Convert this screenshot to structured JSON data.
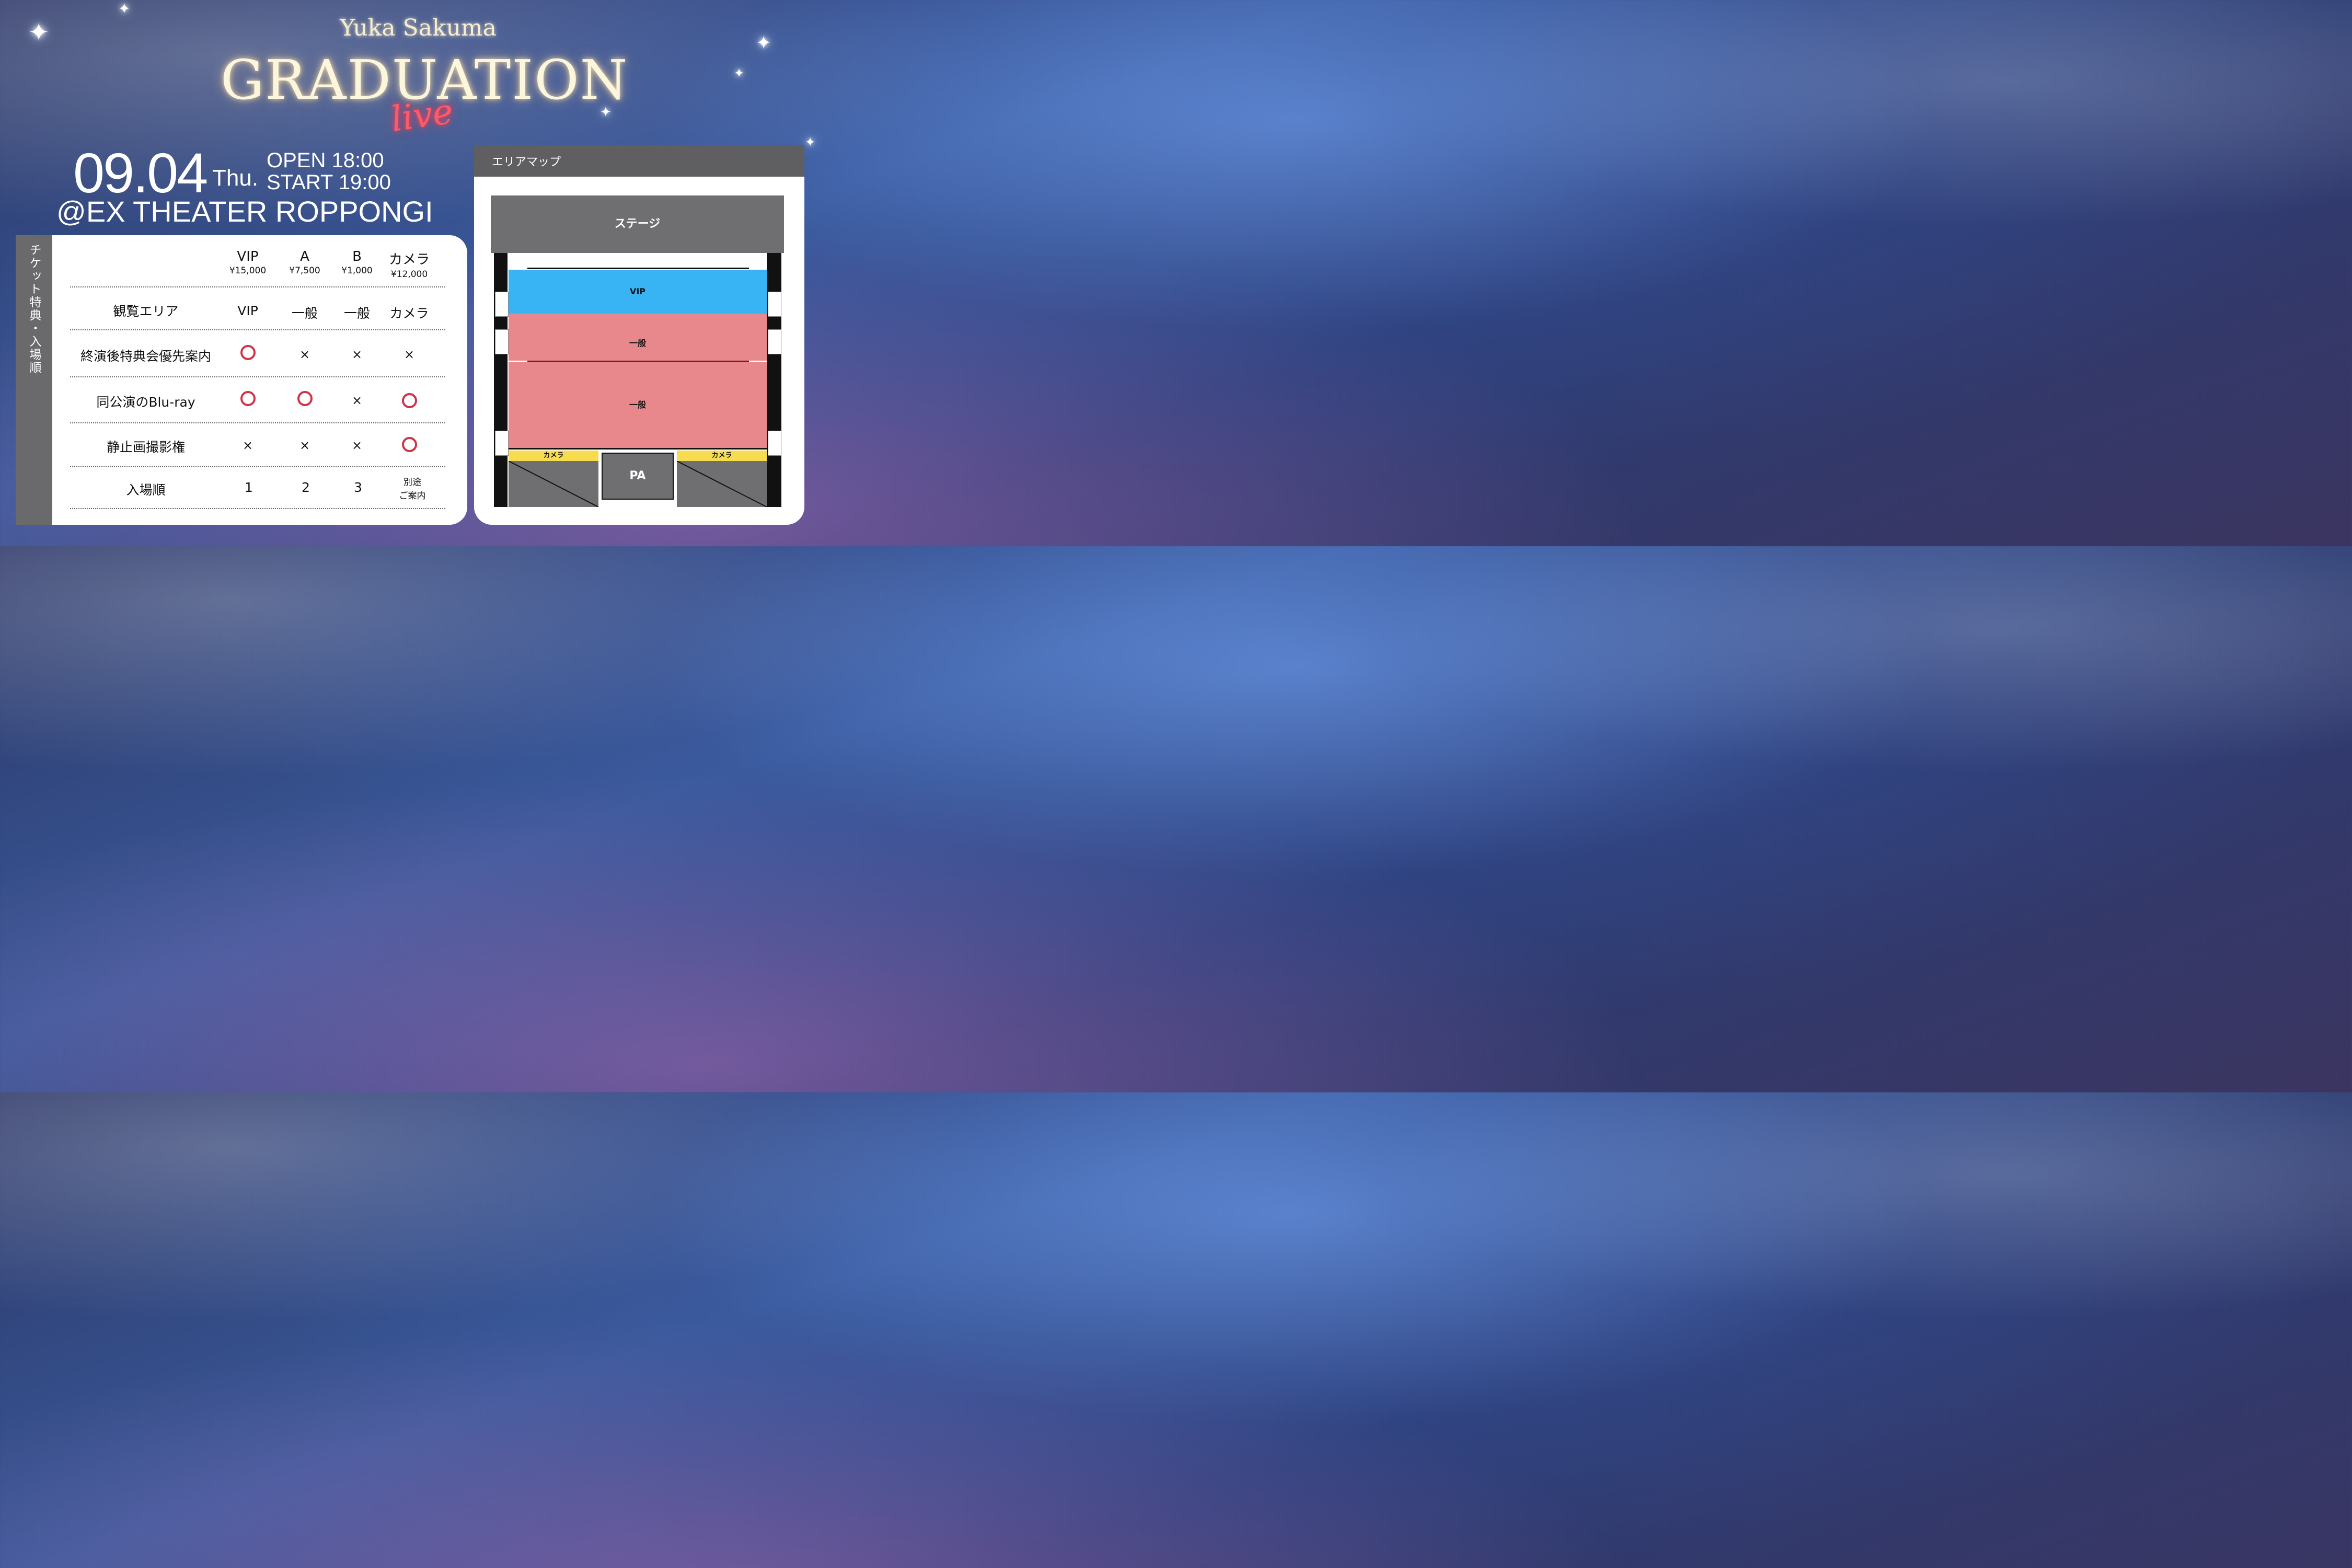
{
  "header": {
    "artist": "Yuka Sakuma",
    "title": "GRADUATION",
    "subtitle": "live",
    "date": "09.04",
    "weekday": "Thu.",
    "open": "OPEN 18:00",
    "start": "START 19:00",
    "venue": "@EX THEATER ROPPONGI"
  },
  "tickets": {
    "side_label": "チケット特典・入場順",
    "tiers": [
      {
        "name": "VIP",
        "price": "¥15,000"
      },
      {
        "name": "A",
        "price": "¥7,500"
      },
      {
        "name": "B",
        "price": "¥1,000"
      },
      {
        "name": "カメラ",
        "price": "¥12,000"
      }
    ],
    "rows": [
      {
        "label": "観覧エリア",
        "values": [
          "VIP",
          "一般",
          "一般",
          "カメラ"
        ]
      },
      {
        "label": "終演後特典会優先案内",
        "values": [
          "○",
          "×",
          "×",
          "×"
        ]
      },
      {
        "label": "同公演のBlu-ray",
        "values": [
          "○",
          "○",
          "×",
          "○"
        ]
      },
      {
        "label": "静止画撮影権",
        "values": [
          "×",
          "×",
          "×",
          "○"
        ]
      },
      {
        "label": "入場順",
        "values": [
          "1",
          "2",
          "3",
          "別途\nご案内"
        ]
      }
    ]
  },
  "area_map": {
    "title": "エリアマップ",
    "stage": "ステージ",
    "vip": "VIP",
    "general_front": "一般",
    "general_back": "一般",
    "camera_left": "カメラ",
    "camera_right": "カメラ",
    "pa": "PA",
    "colors": {
      "vip": "#38b4f4",
      "general": "#e8888c",
      "camera": "#f7dc4f",
      "circle": "#d0324a"
    }
  }
}
